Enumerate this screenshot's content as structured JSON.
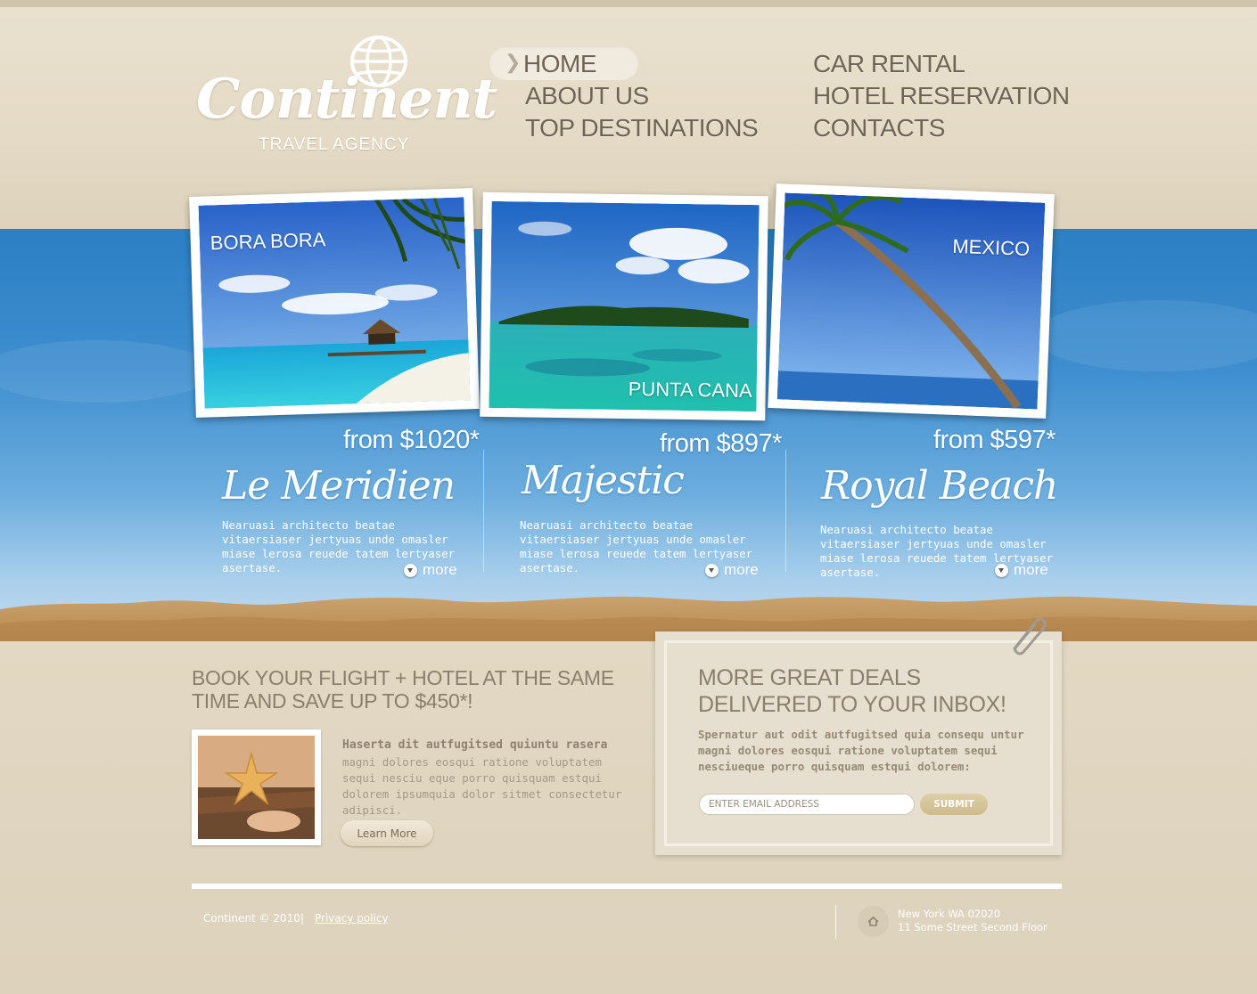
{
  "logo": {
    "word": "Continent",
    "tagline": "TRAVEL AGENCY"
  },
  "nav": {
    "items": [
      {
        "label": "HOME",
        "active": true
      },
      {
        "label": "ABOUT US"
      },
      {
        "label": "TOP DESTINATIONS"
      },
      {
        "label": "CAR RENTAL"
      },
      {
        "label": "HOTEL RESERVATION"
      },
      {
        "label": "CONTACTS"
      }
    ]
  },
  "destinations": [
    {
      "label": "BORA BORA"
    },
    {
      "label": "PUNTA CANA"
    },
    {
      "label": "MEXICO"
    }
  ],
  "offers": [
    {
      "price": "from $1020*",
      "hotel": "Le Meridien",
      "desc": "Nearuasi architecto beatae vitaersiaser jertyuas unde omasler miase lerosa reuede tatem lertyaser asertase.",
      "more": "more"
    },
    {
      "price": "from $897*",
      "hotel": "Majestic",
      "desc": "Nearuasi architecto beatae vitaersiaser jertyuas unde omasler miase lerosa reuede tatem lertyaser asertase.",
      "more": "more"
    },
    {
      "price": "from $597*",
      "hotel": "Royal Beach",
      "desc": "Nearuasi architecto beatae vitaersiaser jertyuas unde omasler miase lerosa reuede tatem lertyaser asertase.",
      "more": "more"
    }
  ],
  "book": {
    "title": "BOOK YOUR FLIGHT + HOTEL AT THE SAME TIME AND SAVE UP TO $450*!",
    "heading": "Haserta dit autfugitsed quiuntu rasera",
    "text": "magni dolores eosqui ratione voluptatem sequi nesciu eque porro quisquam estqui dolorem ipsumquia dolor sitmet consectetur adipisci.",
    "button": "Learn More"
  },
  "newsletter": {
    "title": "MORE GREAT DEALS DELIVERED TO YOUR INBOX!",
    "text": "Spernatur aut odit autfugitsed quia consequ untur magni dolores eosqui ratione voluptatem sequi nesciueque porro quisquam estqui dolorem:",
    "placeholder": "ENTER EMAIL ADDRESS",
    "submit": "SUBMIT"
  },
  "footer": {
    "copyright": "Continent © 2010",
    "separator": "|",
    "privacy": "Privacy policy",
    "address_line1": "New York WA 02020",
    "address_line2": "11 Some Street Second Floor"
  },
  "colors": {
    "beige": "#e2d8c4",
    "sky_top": "#2b7fc3",
    "nav_text": "#6f6453",
    "white": "#ffffff"
  }
}
